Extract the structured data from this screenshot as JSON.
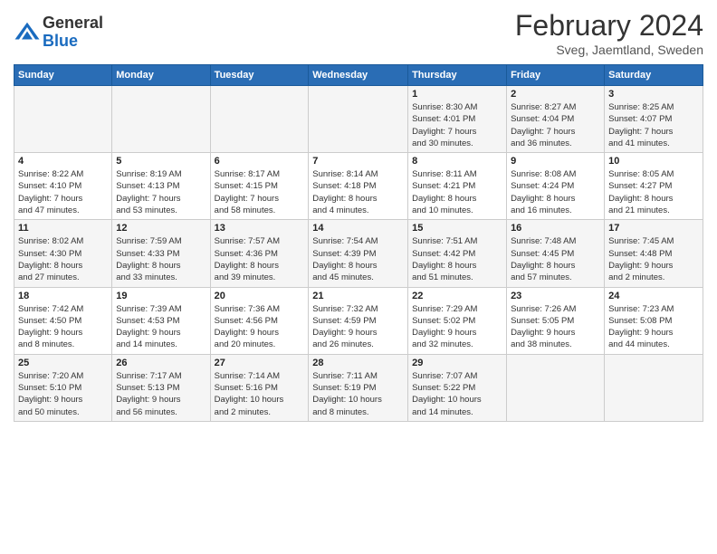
{
  "header": {
    "logo_general": "General",
    "logo_blue": "Blue",
    "month_title": "February 2024",
    "location": "Sveg, Jaemtland, Sweden"
  },
  "weekdays": [
    "Sunday",
    "Monday",
    "Tuesday",
    "Wednesday",
    "Thursday",
    "Friday",
    "Saturday"
  ],
  "weeks": [
    [
      {
        "day": "",
        "info": ""
      },
      {
        "day": "",
        "info": ""
      },
      {
        "day": "",
        "info": ""
      },
      {
        "day": "",
        "info": ""
      },
      {
        "day": "1",
        "info": "Sunrise: 8:30 AM\nSunset: 4:01 PM\nDaylight: 7 hours\nand 30 minutes."
      },
      {
        "day": "2",
        "info": "Sunrise: 8:27 AM\nSunset: 4:04 PM\nDaylight: 7 hours\nand 36 minutes."
      },
      {
        "day": "3",
        "info": "Sunrise: 8:25 AM\nSunset: 4:07 PM\nDaylight: 7 hours\nand 41 minutes."
      }
    ],
    [
      {
        "day": "4",
        "info": "Sunrise: 8:22 AM\nSunset: 4:10 PM\nDaylight: 7 hours\nand 47 minutes."
      },
      {
        "day": "5",
        "info": "Sunrise: 8:19 AM\nSunset: 4:13 PM\nDaylight: 7 hours\nand 53 minutes."
      },
      {
        "day": "6",
        "info": "Sunrise: 8:17 AM\nSunset: 4:15 PM\nDaylight: 7 hours\nand 58 minutes."
      },
      {
        "day": "7",
        "info": "Sunrise: 8:14 AM\nSunset: 4:18 PM\nDaylight: 8 hours\nand 4 minutes."
      },
      {
        "day": "8",
        "info": "Sunrise: 8:11 AM\nSunset: 4:21 PM\nDaylight: 8 hours\nand 10 minutes."
      },
      {
        "day": "9",
        "info": "Sunrise: 8:08 AM\nSunset: 4:24 PM\nDaylight: 8 hours\nand 16 minutes."
      },
      {
        "day": "10",
        "info": "Sunrise: 8:05 AM\nSunset: 4:27 PM\nDaylight: 8 hours\nand 21 minutes."
      }
    ],
    [
      {
        "day": "11",
        "info": "Sunrise: 8:02 AM\nSunset: 4:30 PM\nDaylight: 8 hours\nand 27 minutes."
      },
      {
        "day": "12",
        "info": "Sunrise: 7:59 AM\nSunset: 4:33 PM\nDaylight: 8 hours\nand 33 minutes."
      },
      {
        "day": "13",
        "info": "Sunrise: 7:57 AM\nSunset: 4:36 PM\nDaylight: 8 hours\nand 39 minutes."
      },
      {
        "day": "14",
        "info": "Sunrise: 7:54 AM\nSunset: 4:39 PM\nDaylight: 8 hours\nand 45 minutes."
      },
      {
        "day": "15",
        "info": "Sunrise: 7:51 AM\nSunset: 4:42 PM\nDaylight: 8 hours\nand 51 minutes."
      },
      {
        "day": "16",
        "info": "Sunrise: 7:48 AM\nSunset: 4:45 PM\nDaylight: 8 hours\nand 57 minutes."
      },
      {
        "day": "17",
        "info": "Sunrise: 7:45 AM\nSunset: 4:48 PM\nDaylight: 9 hours\nand 2 minutes."
      }
    ],
    [
      {
        "day": "18",
        "info": "Sunrise: 7:42 AM\nSunset: 4:50 PM\nDaylight: 9 hours\nand 8 minutes."
      },
      {
        "day": "19",
        "info": "Sunrise: 7:39 AM\nSunset: 4:53 PM\nDaylight: 9 hours\nand 14 minutes."
      },
      {
        "day": "20",
        "info": "Sunrise: 7:36 AM\nSunset: 4:56 PM\nDaylight: 9 hours\nand 20 minutes."
      },
      {
        "day": "21",
        "info": "Sunrise: 7:32 AM\nSunset: 4:59 PM\nDaylight: 9 hours\nand 26 minutes."
      },
      {
        "day": "22",
        "info": "Sunrise: 7:29 AM\nSunset: 5:02 PM\nDaylight: 9 hours\nand 32 minutes."
      },
      {
        "day": "23",
        "info": "Sunrise: 7:26 AM\nSunset: 5:05 PM\nDaylight: 9 hours\nand 38 minutes."
      },
      {
        "day": "24",
        "info": "Sunrise: 7:23 AM\nSunset: 5:08 PM\nDaylight: 9 hours\nand 44 minutes."
      }
    ],
    [
      {
        "day": "25",
        "info": "Sunrise: 7:20 AM\nSunset: 5:10 PM\nDaylight: 9 hours\nand 50 minutes."
      },
      {
        "day": "26",
        "info": "Sunrise: 7:17 AM\nSunset: 5:13 PM\nDaylight: 9 hours\nand 56 minutes."
      },
      {
        "day": "27",
        "info": "Sunrise: 7:14 AM\nSunset: 5:16 PM\nDaylight: 10 hours\nand 2 minutes."
      },
      {
        "day": "28",
        "info": "Sunrise: 7:11 AM\nSunset: 5:19 PM\nDaylight: 10 hours\nand 8 minutes."
      },
      {
        "day": "29",
        "info": "Sunrise: 7:07 AM\nSunset: 5:22 PM\nDaylight: 10 hours\nand 14 minutes."
      },
      {
        "day": "",
        "info": ""
      },
      {
        "day": "",
        "info": ""
      }
    ]
  ]
}
